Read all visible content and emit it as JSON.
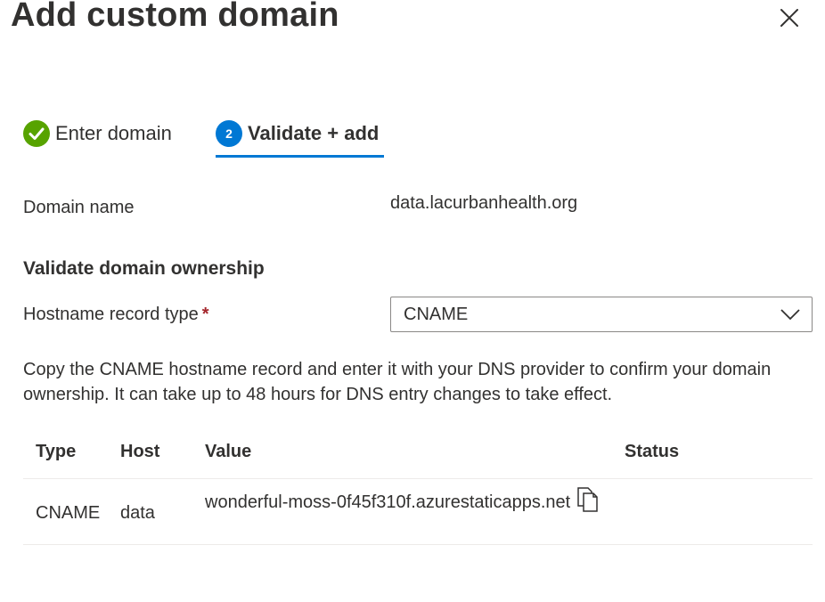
{
  "header": {
    "title": "Add custom domain"
  },
  "steps": [
    {
      "label": "Enter domain",
      "state": "complete",
      "icon": "check-circle-icon"
    },
    {
      "label": "Validate + add",
      "state": "active",
      "number": "2"
    }
  ],
  "domain": {
    "label": "Domain name",
    "value": "data.lacurbanhealth.org"
  },
  "validation": {
    "heading": "Validate domain ownership",
    "record_type_label": "Hostname record type",
    "required_marker": "*",
    "record_type_value": "CNAME",
    "description": "Copy the CNAME hostname record and enter it with your DNS provider to confirm your domain ownership. It can take up to 48 hours for DNS entry changes to take effect."
  },
  "table": {
    "columns": [
      "Type",
      "Host",
      "Value",
      "Status"
    ],
    "rows": [
      {
        "type": "CNAME",
        "host": "data",
        "value": "wonderful-moss-0f45f310f.azurestaticapps.net",
        "status": ""
      }
    ]
  },
  "colors": {
    "accent": "#0078d4",
    "success": "#57a300",
    "required": "#a4262c"
  }
}
